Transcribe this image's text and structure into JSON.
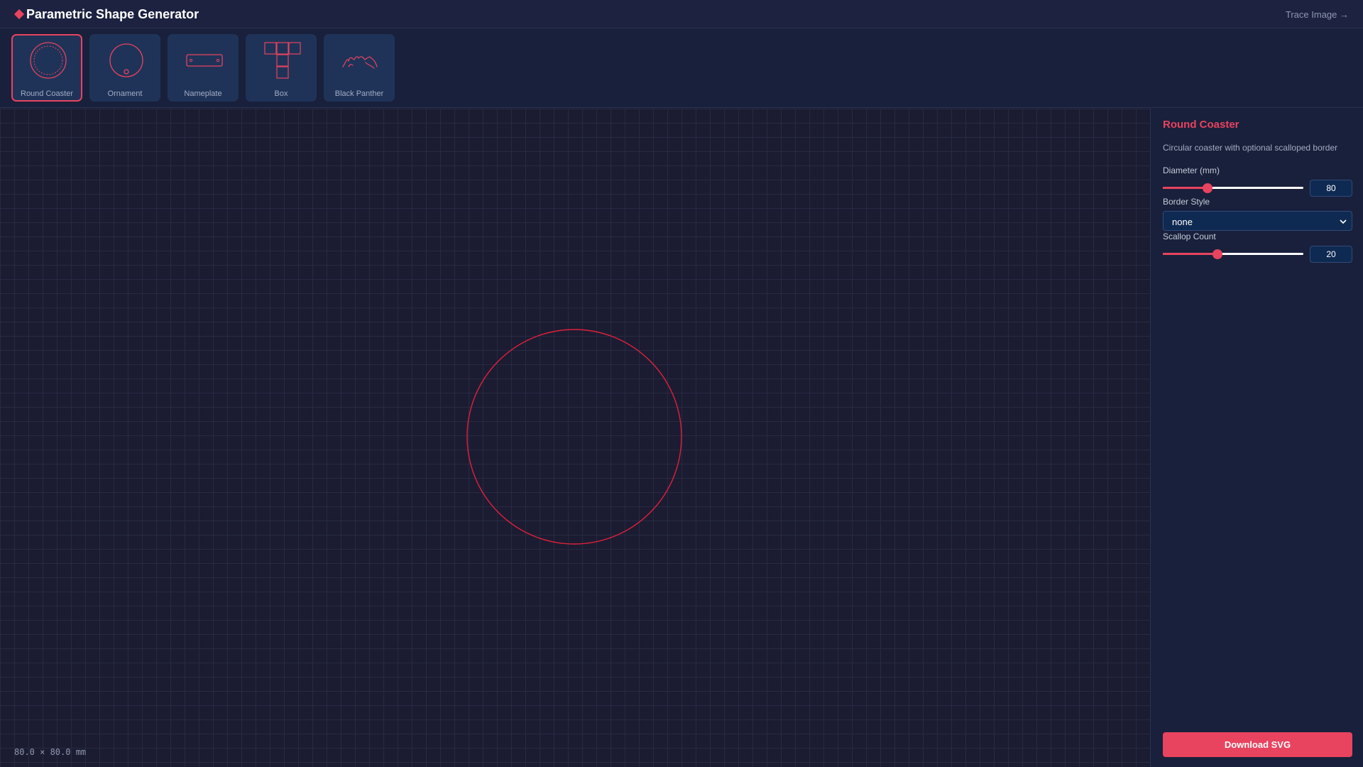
{
  "app": {
    "title": "Parametric Shape Generator",
    "trace_link": "Trace Image →"
  },
  "colors": {
    "accent": "#e8435f",
    "shape_stroke": "#e0203c"
  },
  "shapes": [
    {
      "label": "Round Coaster",
      "icon": "round-coaster-icon",
      "active": true
    },
    {
      "label": "Ornament",
      "icon": "ornament-icon",
      "active": false
    },
    {
      "label": "Nameplate",
      "icon": "nameplate-icon",
      "active": false
    },
    {
      "label": "Box",
      "icon": "box-icon",
      "active": false
    },
    {
      "label": "Black Panther",
      "icon": "black-panther-icon",
      "active": false
    }
  ],
  "canvas": {
    "dimensions": "80.0 × 80.0 mm"
  },
  "panel": {
    "title": "Round Coaster",
    "description": "Circular coaster with optional scalloped border",
    "diameter": {
      "label": "Diameter (mm)",
      "value": "80",
      "fraction": 0.32
    },
    "border_style": {
      "label": "Border Style",
      "value": "none"
    },
    "scallop_count": {
      "label": "Scallop Count",
      "value": "20",
      "fraction": 0.39
    },
    "download_label": "Download SVG"
  }
}
